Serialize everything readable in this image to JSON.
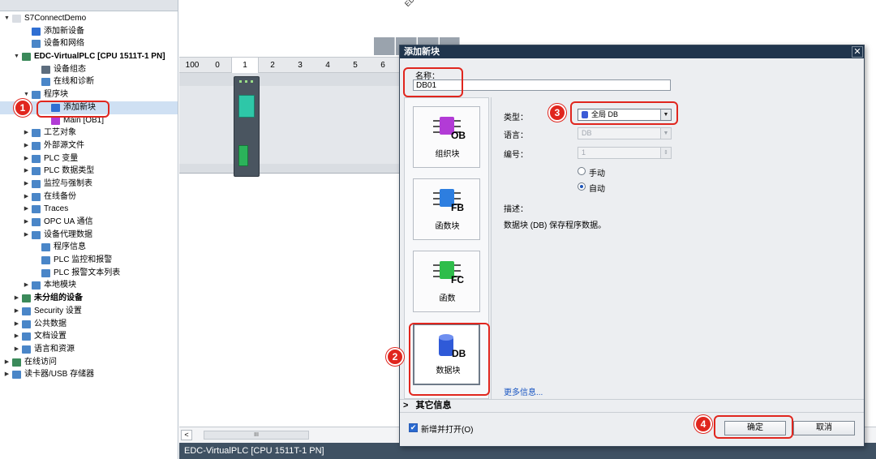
{
  "tree": {
    "items": [
      {
        "label": "S7ConnectDemo",
        "arrow": "▼",
        "icon_color": "#d9dde3",
        "indent": 0
      },
      {
        "label": "添加新设备",
        "arrow": "",
        "icon_color": "#2f6fd3",
        "indent": 2
      },
      {
        "label": "设备和网络",
        "arrow": "",
        "icon_color": "#4a86c8",
        "indent": 2
      },
      {
        "label": "EDC-VirtualPLC [CPU 1511T-1 PN]",
        "arrow": "▼",
        "icon_color": "#3b8a5a",
        "indent": 1,
        "bold": true
      },
      {
        "label": "设备组态",
        "arrow": "",
        "icon_color": "#5d6d7e",
        "indent": 3
      },
      {
        "label": "在线和诊断",
        "arrow": "",
        "icon_color": "#4a86c8",
        "indent": 3
      },
      {
        "label": "程序块",
        "arrow": "▼",
        "icon_color": "#4a86c8",
        "indent": 2
      },
      {
        "label": "添加新块",
        "arrow": "",
        "icon_color": "#2f6fd3",
        "indent": 4,
        "selected": true
      },
      {
        "label": "Main [OB1]",
        "arrow": "",
        "icon_color": "#b23bd6",
        "indent": 4
      },
      {
        "label": "工艺对象",
        "arrow": "▶",
        "icon_color": "#4a86c8",
        "indent": 2
      },
      {
        "label": "外部源文件",
        "arrow": "▶",
        "icon_color": "#4a86c8",
        "indent": 2
      },
      {
        "label": "PLC 变量",
        "arrow": "▶",
        "icon_color": "#4a86c8",
        "indent": 2
      },
      {
        "label": "PLC 数据类型",
        "arrow": "▶",
        "icon_color": "#4a86c8",
        "indent": 2
      },
      {
        "label": "监控与强制表",
        "arrow": "▶",
        "icon_color": "#4a86c8",
        "indent": 2
      },
      {
        "label": "在线备份",
        "arrow": "▶",
        "icon_color": "#4a86c8",
        "indent": 2
      },
      {
        "label": "Traces",
        "arrow": "▶",
        "icon_color": "#4a86c8",
        "indent": 2
      },
      {
        "label": "OPC UA 通信",
        "arrow": "▶",
        "icon_color": "#4a86c8",
        "indent": 2
      },
      {
        "label": "设备代理数据",
        "arrow": "▶",
        "icon_color": "#4a86c8",
        "indent": 2
      },
      {
        "label": "程序信息",
        "arrow": "",
        "icon_color": "#4a86c8",
        "indent": 3
      },
      {
        "label": "PLC 监控和报警",
        "arrow": "",
        "icon_color": "#4a86c8",
        "indent": 3
      },
      {
        "label": "PLC 报警文本列表",
        "arrow": "",
        "icon_color": "#4a86c8",
        "indent": 3
      },
      {
        "label": "本地模块",
        "arrow": "▶",
        "icon_color": "#4a86c8",
        "indent": 2
      },
      {
        "label": "未分组的设备",
        "arrow": "▶",
        "icon_color": "#3b8a5a",
        "indent": 1,
        "bold": true
      },
      {
        "label": "Security 设置",
        "arrow": "▶",
        "icon_color": "#4a86c8",
        "indent": 1
      },
      {
        "label": "公共数据",
        "arrow": "▶",
        "icon_color": "#4a86c8",
        "indent": 1
      },
      {
        "label": "文档设置",
        "arrow": "▶",
        "icon_color": "#4a86c8",
        "indent": 1
      },
      {
        "label": "语言和资源",
        "arrow": "▶",
        "icon_color": "#4a86c8",
        "indent": 1
      },
      {
        "label": "在线访问",
        "arrow": "▶",
        "icon_color": "#3b8a5a",
        "indent": 0
      },
      {
        "label": "读卡器/USB 存储器",
        "arrow": "▶",
        "icon_color": "#4a86c8",
        "indent": 0
      }
    ]
  },
  "device_view": {
    "rack_label": "EDC-Virtual",
    "slots": [
      "100",
      "0",
      "1",
      "2",
      "3",
      "4",
      "5",
      "6"
    ],
    "active_slot": "1",
    "scroll_thumb": "III",
    "status_bar": "EDC-VirtualPLC [CPU 1511T-1 PN]"
  },
  "dialog": {
    "title": "添加新块",
    "close_glyph": "✕",
    "name_label": "名称：",
    "name_value": "DB01",
    "blocks": [
      {
        "tag": "OB",
        "label": "组织块",
        "color": "#b23bd6"
      },
      {
        "tag": "FB",
        "label": "函数块",
        "color": "#2d7ee0"
      },
      {
        "tag": "FC",
        "label": "函数",
        "color": "#2ebd4a"
      },
      {
        "tag": "DB",
        "label": "数据块",
        "color": "#2f5ad8"
      }
    ],
    "type_label": "类型：",
    "type_value": "全局 DB",
    "language_label": "语言：",
    "language_value": "DB",
    "number_label": "编号：",
    "number_value": "1",
    "radio_manual": "手动",
    "radio_auto": "自动",
    "radio_selected": "auto",
    "desc_label": "描述：",
    "desc_text": "数据块 (DB) 保存程序数据。",
    "more_info": "更多信息...",
    "other_info": "其它信息",
    "other_arrow": ">",
    "add_open_label": "新增并打开(O)",
    "add_open_checked": true,
    "ok_label": "确定",
    "cancel_label": "取消"
  },
  "annotations": {
    "steps": [
      "1",
      "2",
      "3",
      "4"
    ],
    "color": "#e0261e"
  }
}
